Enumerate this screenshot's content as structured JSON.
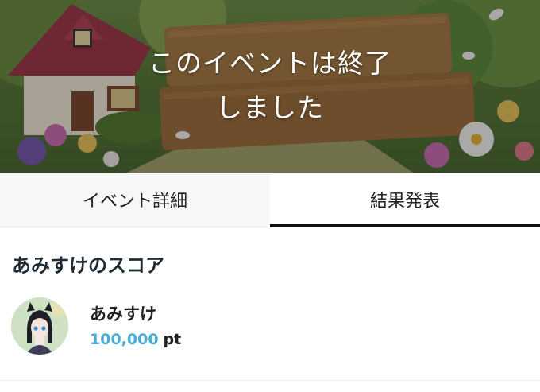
{
  "banner": {
    "ended_line1": "このイベントは終了",
    "ended_line2": "しました"
  },
  "tabs": [
    {
      "label": "イベント詳細",
      "active": false
    },
    {
      "label": "結果発表",
      "active": true
    }
  ],
  "score_section": {
    "title": "あみすけのスコア",
    "user": {
      "name": "あみすけ",
      "points": "100,000",
      "unit": "pt"
    }
  },
  "colors": {
    "points": "#4aaed6",
    "tab_indicator": "#111111"
  }
}
